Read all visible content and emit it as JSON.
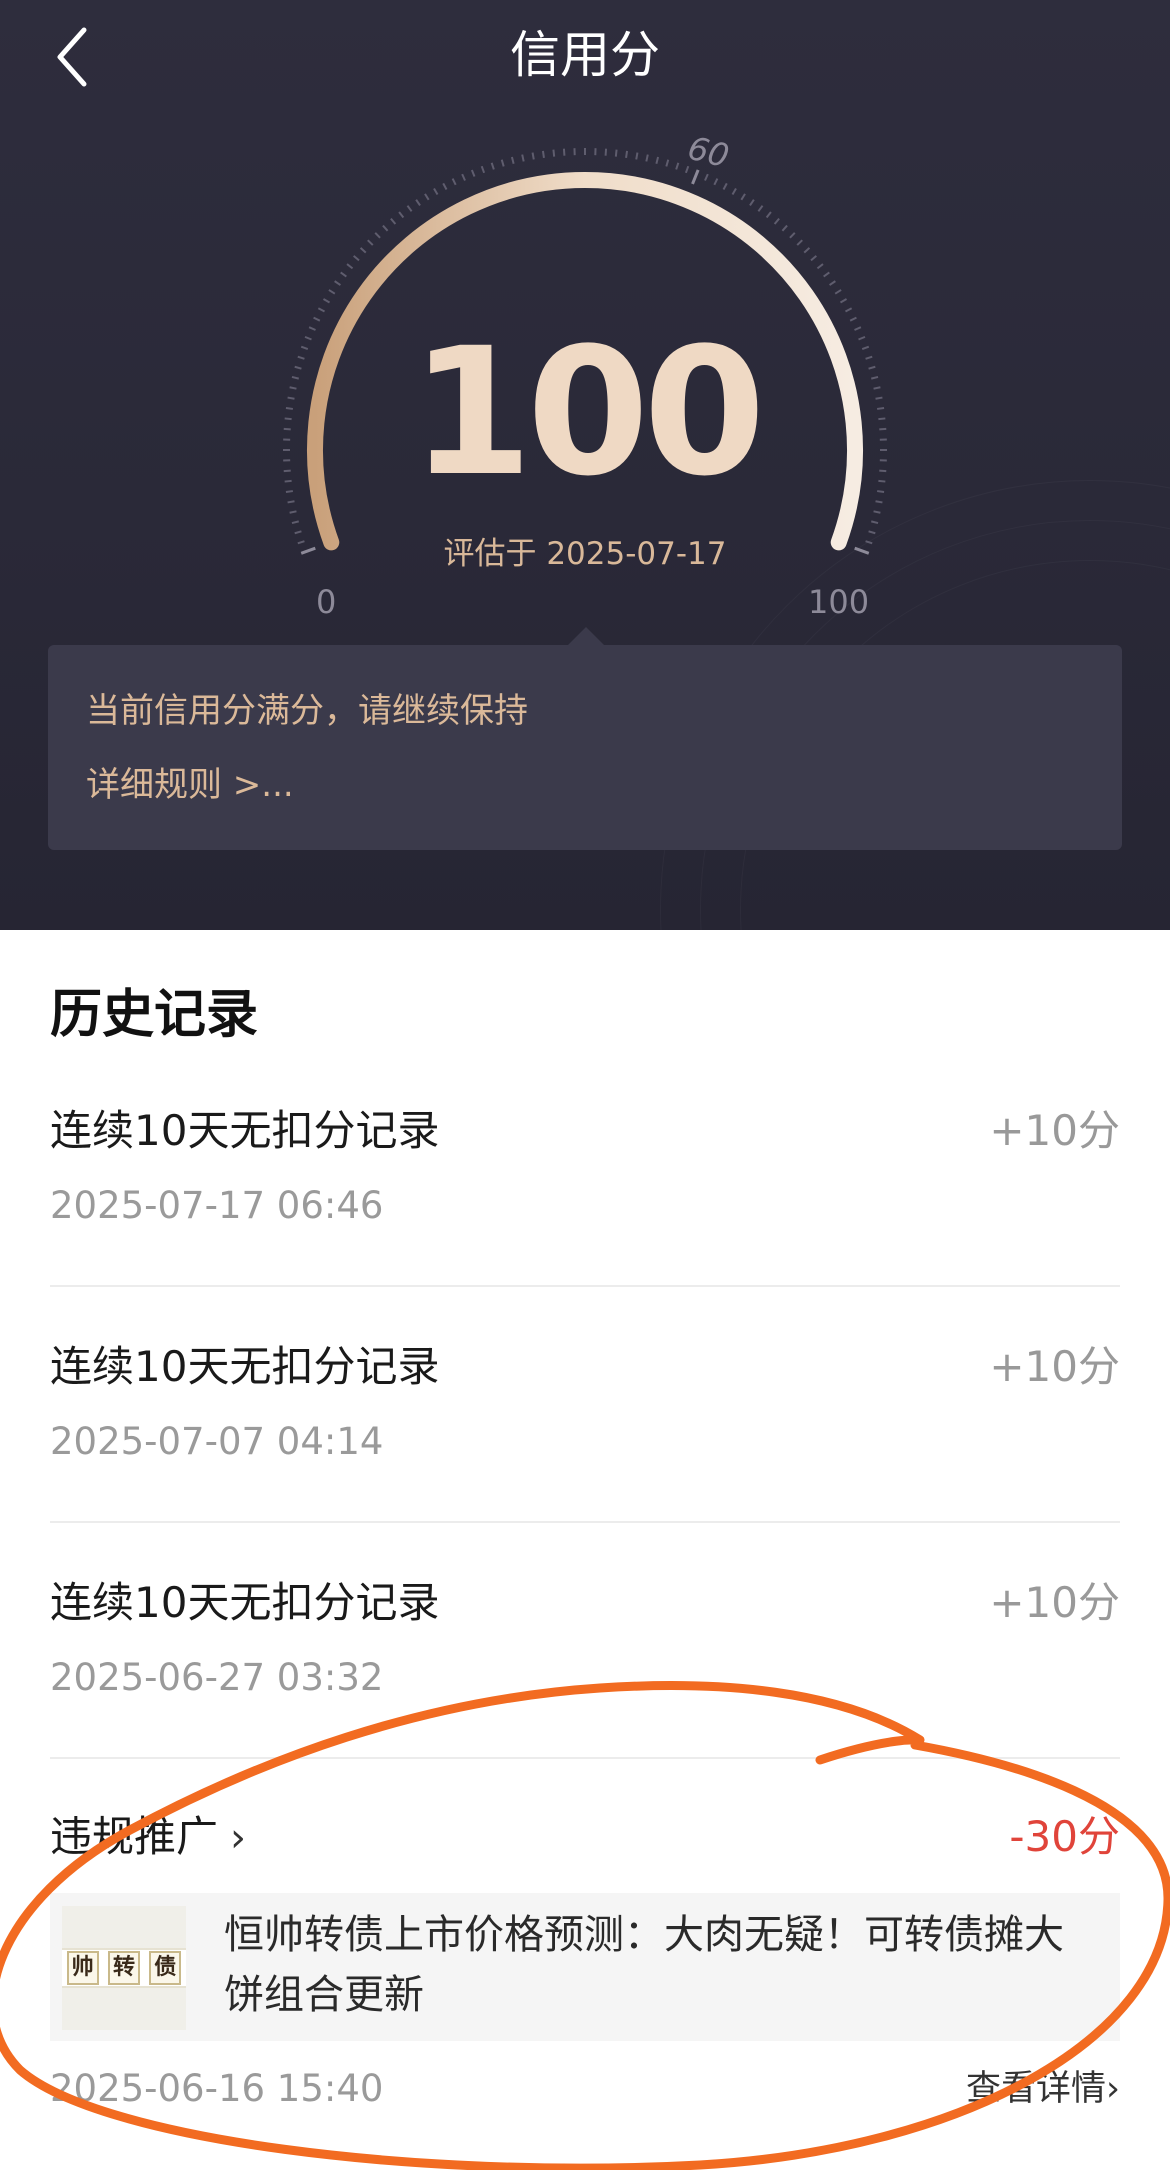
{
  "nav": {
    "title": "信用分"
  },
  "gauge": {
    "score": "100",
    "evaluated": "评估于 2025-07-17",
    "min_label": "0",
    "max_label": "100",
    "mid_label": "60",
    "level": 1.0
  },
  "tip": {
    "message": "当前信用分满分，请继续保持",
    "rules_link": "详细规则 >..."
  },
  "history": {
    "title": "历史记录",
    "records": [
      {
        "title": "连续10天无扣分记录",
        "score": "+10分",
        "date": "2025-07-17 06:46"
      },
      {
        "title": "连续10天无扣分记录",
        "score": "+10分",
        "date": "2025-07-07 04:14"
      },
      {
        "title": "连续10天无扣分记录",
        "score": "+10分",
        "date": "2025-06-27 03:32"
      },
      {
        "title": "违规推广",
        "score": "-30分",
        "date": "2025-06-16 15:40",
        "article_title": "恒帅转债上市价格预测：大肉无疑！可转债摊大饼组合更新",
        "thumb_chars": [
          "帅",
          "转",
          "债"
        ],
        "detail_link": "查看详情"
      }
    ]
  },
  "colors": {
    "header_bg": "#2a2938",
    "accent_gold": "#dbb999",
    "negative_red": "#e0443a",
    "annotation_orange": "#f26b21"
  }
}
